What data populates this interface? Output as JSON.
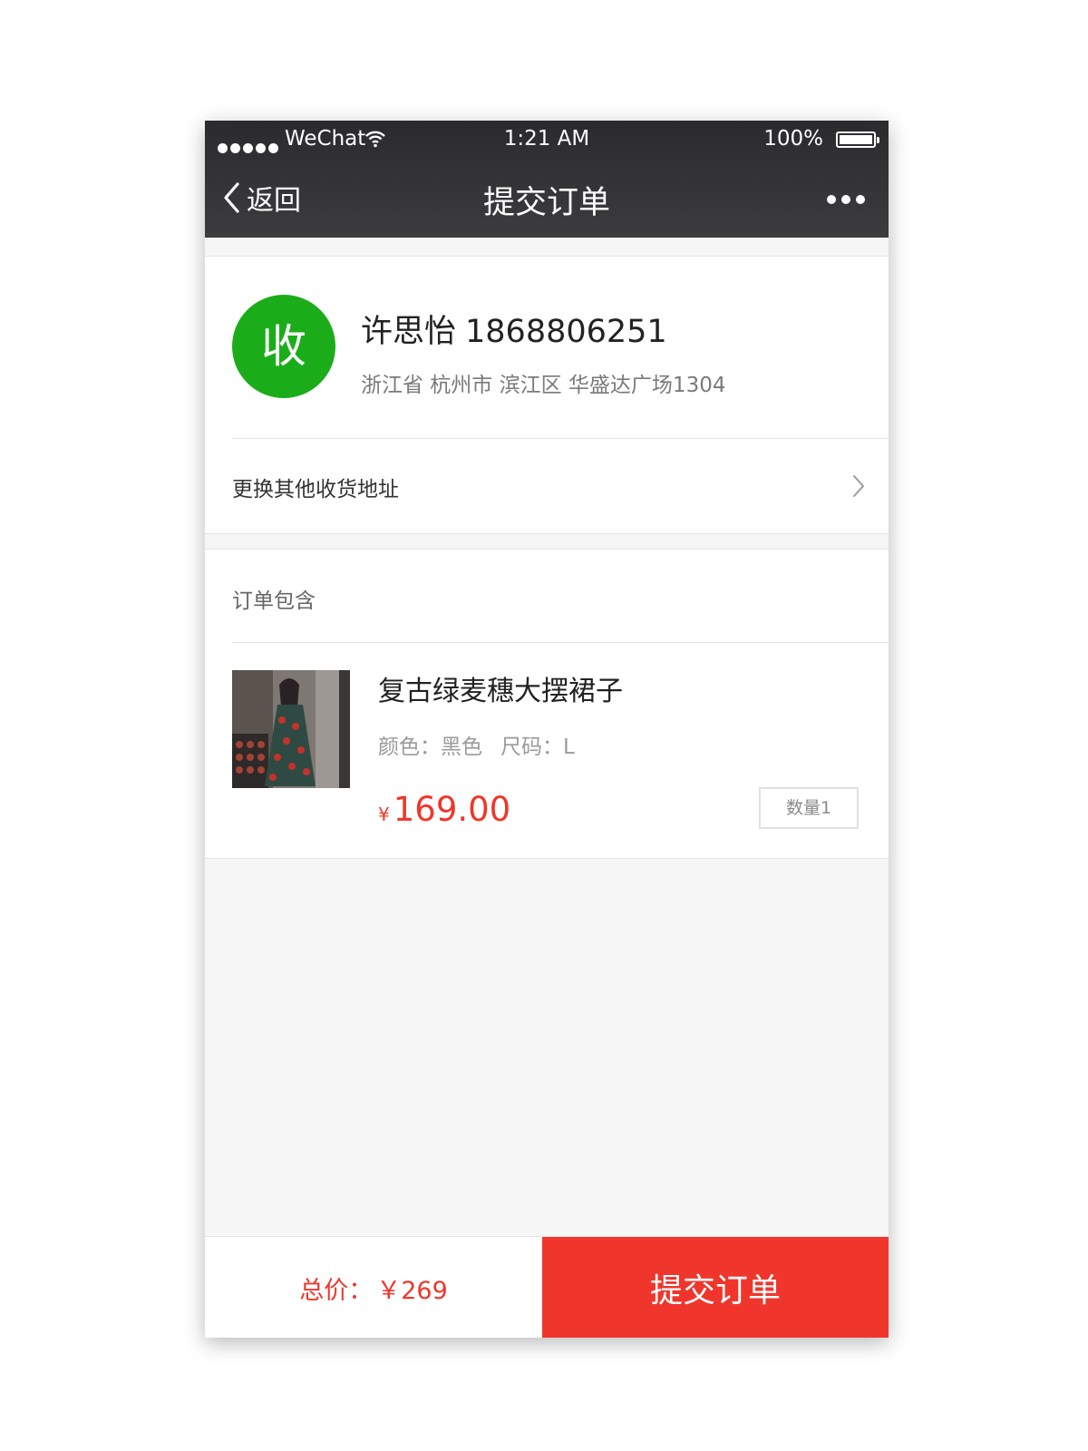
{
  "status_bar": {
    "carrier": "WeChat",
    "time": "1:21 AM",
    "battery": "100%"
  },
  "nav": {
    "back_label": "返回",
    "title": "提交订单"
  },
  "address": {
    "avatar_text": "收",
    "name": "许思怡",
    "phone": "1868806251",
    "detail": "浙江省 杭州市 滨江区 华盛达广场1304",
    "change_label": "更换其他收货地址"
  },
  "order": {
    "header": "订单包含",
    "item": {
      "title": "复古绿麦穗大摆裙子",
      "color_label": "颜色：",
      "color_value": "黑色",
      "size_label": "尺码：",
      "size_value": "L",
      "currency": "¥",
      "price": "169.00",
      "quantity": "数量1"
    }
  },
  "footer": {
    "total_label": "总价：",
    "total_value": "￥269",
    "submit_label": "提交订单"
  },
  "colors": {
    "accent_red": "#f0362c",
    "avatar_green": "#1aad19",
    "nav_bg": "#333335"
  }
}
